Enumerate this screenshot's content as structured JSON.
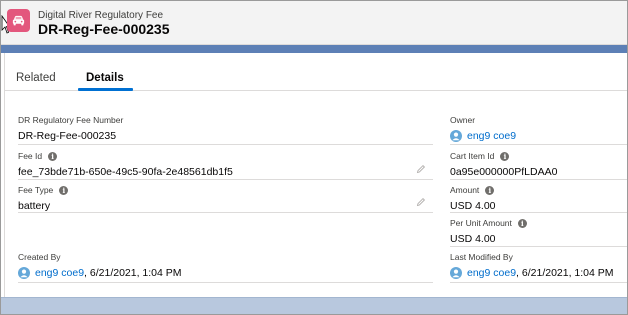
{
  "header": {
    "object_type": "Digital River Regulatory Fee",
    "record_name": "DR-Reg-Fee-000235"
  },
  "tabs": [
    {
      "label": "Related"
    },
    {
      "label": "Details"
    }
  ],
  "fields": {
    "fee_number": {
      "label": "DR Regulatory Fee Number",
      "value": "DR-Reg-Fee-000235"
    },
    "owner": {
      "label": "Owner",
      "value": "eng9 coe9"
    },
    "fee_id": {
      "label": "Fee Id",
      "value": "fee_73bde71b-650e-49c5-90fa-2e48561db1f5"
    },
    "cart_item_id": {
      "label": "Cart Item Id",
      "value": "0a95e000000PfLDAA0"
    },
    "fee_type": {
      "label": "Fee Type",
      "value": "battery"
    },
    "amount": {
      "label": "Amount",
      "value": "USD 4.00"
    },
    "per_unit_amount": {
      "label": "Per Unit Amount",
      "value": "USD 4.00"
    },
    "created_by": {
      "label": "Created By",
      "user": "eng9 coe9",
      "date": ", 6/21/2021, 1:04 PM"
    },
    "last_modified_by": {
      "label": "Last Modified By",
      "user": "eng9 coe9",
      "date": ", 6/21/2021, 1:04 PM"
    }
  },
  "icons": {
    "object_icon": "car-icon",
    "info_icon": "info-icon",
    "edit_icon": "pencil-icon",
    "user_icon": "user-avatar-icon"
  },
  "colors": {
    "object_icon_bg": "#e3577d",
    "link": "#006dcc",
    "active_tab": "#0070d2",
    "band": "#5d80b6"
  }
}
